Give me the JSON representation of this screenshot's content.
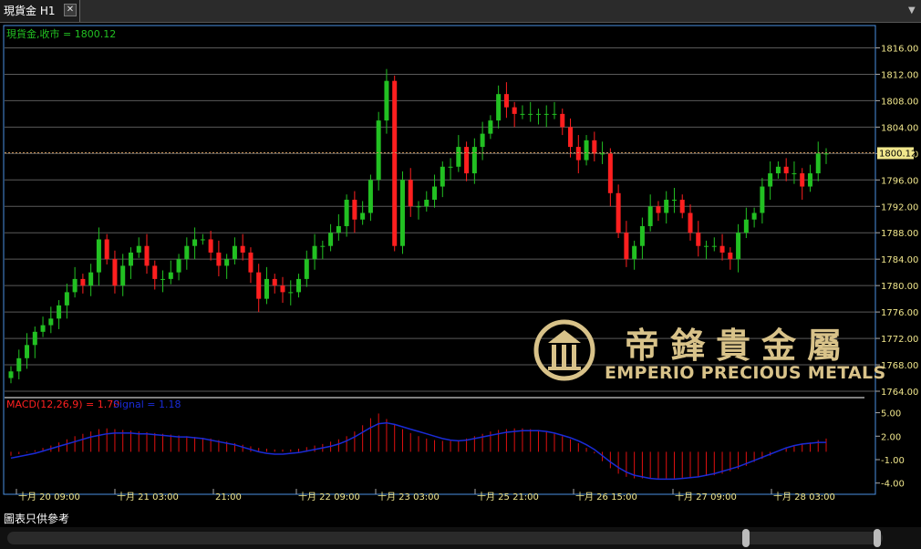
{
  "window": {
    "tab_title": "現貨金 H1",
    "tab_close_label": "✕",
    "menu_arrow": "▼"
  },
  "price_panel": {
    "symbol_label": "現貨金,收市 = 1800.12",
    "current_price": 1800.12,
    "current_price_label": "1800.12",
    "y_ticks": [
      "1816.00",
      "1812.00",
      "1808.00",
      "1804.00",
      "1800.00",
      "1796.00",
      "1792.00",
      "1788.00",
      "1784.00",
      "1780.00",
      "1776.00",
      "1772.00",
      "1768.00",
      "1764.00"
    ]
  },
  "macd_panel": {
    "label_main": "MACD(12,26,9) = 1.70",
    "label_signal": "Signal = 1.18",
    "y_ticks": [
      "5.00",
      "2.00",
      "-1.00",
      "-4.00"
    ]
  },
  "x_axis": {
    "ticks": [
      "十月 20 09:00",
      "十月 21 03:00",
      "21:00",
      "十月 22 09:00",
      "十月 23 03:00",
      "十月 25 21:00",
      "十月 26 15:00",
      "十月 27 09:00",
      "十月 28 03:00"
    ]
  },
  "footer": {
    "disclaimer": "圖表只供參考"
  },
  "watermark": {
    "zh": "帝鋒貴金屬",
    "en": "EMPERIO PRECIOUS METALS"
  },
  "colors": {
    "up": "#22c022",
    "down": "#ff1f1f",
    "grid": "#5a5a5a",
    "axis_text": "#f0e68c",
    "macd_hist": "#e01010",
    "signal": "#1a2bd6",
    "price_line": "#c8945a"
  },
  "chart_data": {
    "type": "candlestick",
    "price_ylim": [
      1764,
      1818
    ],
    "macd_ylim": [
      -4.5,
      6
    ],
    "closes": [
      1767,
      1769,
      1771,
      1773,
      1774,
      1775,
      1777,
      1779,
      1781,
      1780,
      1782,
      1787,
      1784,
      1780,
      1783,
      1785,
      1786,
      1783,
      1781,
      1781,
      1782,
      1784,
      1786,
      1787,
      1787,
      1785,
      1783,
      1784,
      1786,
      1785,
      1782,
      1778,
      1781,
      1780,
      1779,
      1779,
      1781,
      1784,
      1786,
      1786,
      1788,
      1789,
      1793,
      1790,
      1791,
      1796,
      1805,
      1811,
      1786,
      1796,
      1792,
      1792,
      1793,
      1795,
      1798,
      1798,
      1801,
      1797,
      1801,
      1803,
      1805,
      1809,
      1807,
      1806,
      1806,
      1806,
      1806,
      1806,
      1806,
      1804,
      1801,
      1799,
      1802,
      1800,
      1800,
      1794,
      1788,
      1784,
      1786,
      1789,
      1792,
      1791,
      1793,
      1793,
      1791,
      1788,
      1786,
      1786,
      1786,
      1785,
      1784,
      1788,
      1790,
      1791,
      1795,
      1797,
      1798,
      1797,
      1797,
      1795,
      1797,
      1800,
      1800
    ],
    "macd_hist": [
      -0.5,
      -0.3,
      -0.1,
      0.2,
      0.5,
      0.8,
      1.2,
      1.6,
      2.0,
      2.3,
      2.6,
      2.9,
      3.0,
      2.9,
      2.8,
      2.7,
      2.6,
      2.5,
      2.4,
      2.3,
      2.2,
      2.1,
      2.0,
      1.9,
      1.8,
      1.7,
      1.5,
      1.3,
      1.1,
      0.9,
      0.7,
      0.5,
      0.4,
      0.3,
      0.3,
      0.3,
      0.4,
      0.6,
      0.8,
      1.0,
      1.3,
      1.6,
      2.0,
      2.6,
      3.4,
      4.3,
      4.9,
      4.2,
      3.5,
      2.9,
      2.4,
      2.0,
      1.7,
      1.5,
      1.4,
      1.4,
      1.5,
      1.7,
      2.0,
      2.3,
      2.6,
      2.8,
      2.9,
      3.0,
      3.0,
      2.9,
      2.8,
      2.6,
      2.3,
      2.0,
      1.6,
      1.1,
      0.5,
      -0.2,
      -1.2,
      -2.1,
      -2.8,
      -3.2,
      -3.4,
      -3.4,
      -3.4,
      -3.4,
      -3.4,
      -3.4,
      -3.4,
      -3.3,
      -3.2,
      -3.1,
      -3.0,
      -2.8,
      -2.5,
      -2.2,
      -1.8,
      -1.3,
      -0.9,
      -0.5,
      0.0,
      0.4,
      0.7,
      1.0,
      1.2,
      1.5,
      1.7
    ],
    "signal": [
      -0.8,
      -0.6,
      -0.4,
      -0.2,
      0.1,
      0.4,
      0.7,
      1.0,
      1.3,
      1.6,
      1.9,
      2.1,
      2.3,
      2.4,
      2.4,
      2.4,
      2.3,
      2.3,
      2.2,
      2.1,
      2.0,
      1.9,
      1.9,
      1.8,
      1.7,
      1.5,
      1.3,
      1.1,
      0.9,
      0.6,
      0.3,
      0.0,
      -0.2,
      -0.3,
      -0.3,
      -0.2,
      -0.1,
      0.1,
      0.3,
      0.5,
      0.7,
      1.0,
      1.4,
      1.9,
      2.5,
      3.1,
      3.6,
      3.7,
      3.5,
      3.2,
      2.9,
      2.6,
      2.3,
      2.0,
      1.7,
      1.5,
      1.4,
      1.5,
      1.7,
      1.9,
      2.1,
      2.3,
      2.5,
      2.6,
      2.7,
      2.7,
      2.7,
      2.6,
      2.4,
      2.1,
      1.8,
      1.4,
      0.9,
      0.3,
      -0.5,
      -1.3,
      -2.0,
      -2.6,
      -3.0,
      -3.2,
      -3.4,
      -3.5,
      -3.5,
      -3.5,
      -3.4,
      -3.3,
      -3.2,
      -3.0,
      -2.8,
      -2.5,
      -2.2,
      -1.9,
      -1.5,
      -1.1,
      -0.7,
      -0.3,
      0.1,
      0.5,
      0.8,
      1.0,
      1.1,
      1.2,
      1.2
    ]
  }
}
